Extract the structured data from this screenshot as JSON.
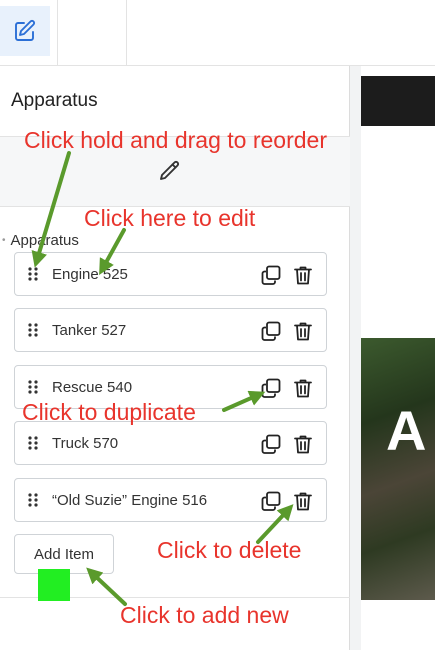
{
  "toolbar": {
    "edit_icon": "pencil-square-icon",
    "preview_icon": "monitor-icon"
  },
  "panel": {
    "title": "Apparatus",
    "edit_icon": "pencil-icon",
    "section_label": "Apparatus",
    "items": [
      {
        "label": "Engine 525"
      },
      {
        "label": "Tanker 527"
      },
      {
        "label": "Rescue 540"
      },
      {
        "label": "Truck 570"
      },
      {
        "label": "“Old Suzie” Engine 516"
      }
    ],
    "add_item_label": "Add Item"
  },
  "preview": {
    "hero_letter": "A"
  },
  "annotations": {
    "reorder": "Click hold and drag to reorder",
    "edit": "Click here to edit",
    "duplicate": "Click to duplicate",
    "delete": "Click to delete",
    "add_new": "Click to add new"
  },
  "colors": {
    "annotation_text": "#e8342c",
    "arrow": "#5a9a2c",
    "green_marker": "#22ee22",
    "active_tab_bg": "#e8f1fc",
    "accent_icon": "#2b6fd6"
  }
}
